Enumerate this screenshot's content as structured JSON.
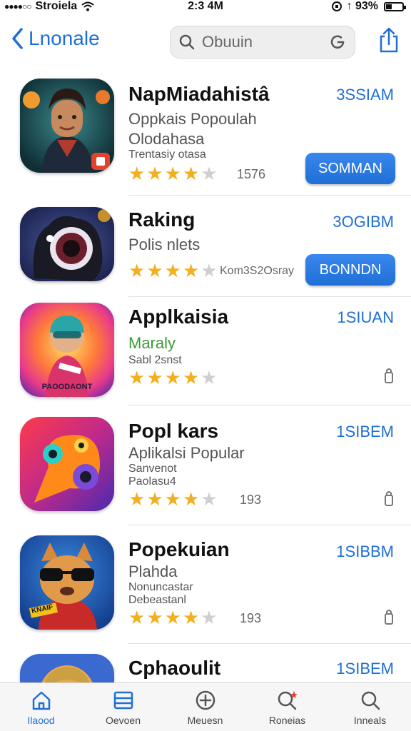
{
  "status_bar": {
    "carrier": "Stroiela",
    "time": "2:3 4M",
    "battery": "↑ 93%"
  },
  "nav": {
    "back_label": "Lnonale",
    "search_text": "Obuuin"
  },
  "apps": [
    {
      "title": "NapMiadahistâ",
      "subtitle": "Oppkais Popoulah",
      "line2": "Olodahasa",
      "meta": "Trentasiy otasa",
      "size": "3SSIAM",
      "rating": 4,
      "count": "1576",
      "button": "SOMMAN"
    },
    {
      "title": "Raking",
      "subtitle": "Polis nlets",
      "size": "3OGIBM",
      "rating": 4,
      "count": "Kom3S2Osray",
      "button": "BONNDN"
    },
    {
      "title": "Applkaisia",
      "subtitle": "Maraly",
      "meta": "Sabl 2snst",
      "size": "1SIUAN",
      "rating": 4,
      "icon_label": "PAOODAONT"
    },
    {
      "title": "Popl kars",
      "subtitle": "Aplikalsi Popular",
      "meta": "Sanvenot",
      "meta2": "Paolasu4",
      "size": "1SIBEM",
      "rating": 4,
      "count": "193"
    },
    {
      "title": "Popekuian",
      "subtitle": "Plahda",
      "meta": "Nonuncastar",
      "meta2": "Debeastanl",
      "size": "1SIBBM",
      "rating": 4,
      "count": "193",
      "icon_label": "KNAIF"
    },
    {
      "title": "Cphaoulit",
      "size": "1SIBEM"
    }
  ],
  "tabs": [
    {
      "label": "Ilaood",
      "icon": "home-icon"
    },
    {
      "label": "Oevoen",
      "icon": "list-icon"
    },
    {
      "label": "Meuesn",
      "icon": "plus-icon"
    },
    {
      "label": "Roneias",
      "icon": "search-star-icon"
    },
    {
      "label": "Inneals",
      "icon": "search-icon"
    }
  ],
  "colors": {
    "accent": "#1f6fd6",
    "star": "#f2b01e",
    "green_text": "#3e9a3a"
  }
}
